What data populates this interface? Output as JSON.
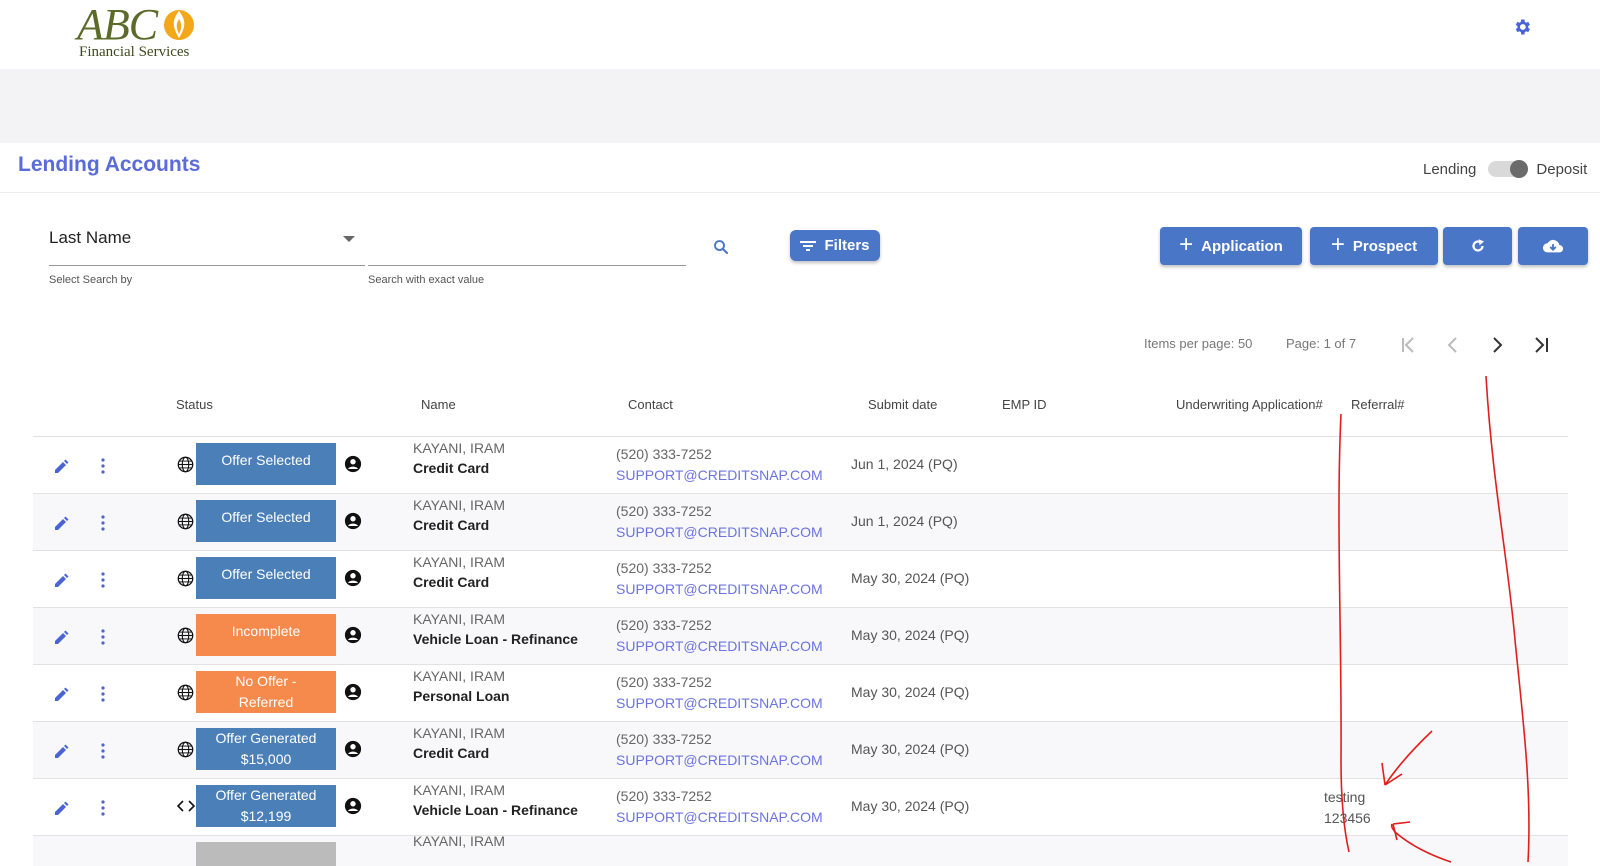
{
  "brand": {
    "logo_text": "ABC",
    "logo_subtitle": "Financial Services"
  },
  "header": {
    "settings_icon": "gear-icon"
  },
  "page": {
    "title": "Lending Accounts"
  },
  "toggle": {
    "left_label": "Lending",
    "right_label": "Deposit",
    "selected": "Deposit"
  },
  "search": {
    "select_value": "Last Name",
    "select_hint": "Select Search by",
    "input_placeholder": "",
    "input_hint": "Search with exact value"
  },
  "toolbar": {
    "filters_label": "Filters",
    "application_label": "Application",
    "prospect_label": "Prospect",
    "refresh_icon": "refresh-icon",
    "download_icon": "cloud-download-icon"
  },
  "pagination": {
    "items_per_page": "Items per page: 50",
    "page_info": "Page: 1 of 7"
  },
  "table": {
    "headers": {
      "status": "Status",
      "name": "Name",
      "contact": "Contact",
      "submit_date": "Submit date",
      "emp_id": "EMP ID",
      "underwriting": "Underwriting Application#",
      "referral": "Referral#"
    },
    "rows": [
      {
        "channel_icon": "globe-icon",
        "status": "Offer Selected",
        "status_color": "#4a7fb8",
        "last_first": "KAYANI,  IRAM",
        "product": "Credit Card",
        "phone": "(520) 333-7252",
        "email": "SUPPORT@CREDITSNAP.COM",
        "date": "Jun 1, 2024 (PQ)",
        "referral_1": "",
        "referral_2": ""
      },
      {
        "channel_icon": "globe-icon",
        "status": "Offer Selected",
        "status_color": "#4a7fb8",
        "last_first": "KAYANI,  IRAM",
        "product": "Credit Card",
        "phone": "(520) 333-7252",
        "email": "SUPPORT@CREDITSNAP.COM",
        "date": "Jun 1, 2024 (PQ)",
        "referral_1": "",
        "referral_2": ""
      },
      {
        "channel_icon": "globe-icon",
        "status": "Offer Selected",
        "status_color": "#4a7fb8",
        "last_first": "KAYANI,  IRAM",
        "product": "Credit Card",
        "phone": "(520) 333-7252",
        "email": "SUPPORT@CREDITSNAP.COM",
        "date": "May 30, 2024 (PQ)",
        "referral_1": "",
        "referral_2": ""
      },
      {
        "channel_icon": "globe-icon",
        "status": "Incomplete",
        "status_color": "#f58a4c",
        "last_first": "KAYANI,  IRAM",
        "product": "Vehicle Loan - Refinance",
        "phone": "(520) 333-7252",
        "email": "SUPPORT@CREDITSNAP.COM",
        "date": "May 30, 2024 (PQ)",
        "referral_1": "",
        "referral_2": ""
      },
      {
        "channel_icon": "globe-icon",
        "status_line1": "No Offer -",
        "status_line2": "Referred",
        "status_color": "#f58a4c",
        "last_first": "KAYANI,  IRAM",
        "product": "Personal Loan",
        "phone": "(520) 333-7252",
        "email": "SUPPORT@CREDITSNAP.COM",
        "date": "May 30, 2024 (PQ)",
        "referral_1": "",
        "referral_2": ""
      },
      {
        "channel_icon": "globe-icon",
        "status_line1": "Offer Generated",
        "status_line2": "$15,000",
        "status_color": "#4a7fb8",
        "last_first": "KAYANI,  IRAM",
        "product": "Credit Card",
        "phone": "(520) 333-7252",
        "email": "SUPPORT@CREDITSNAP.COM",
        "date": "May 30, 2024 (PQ)",
        "referral_1": "",
        "referral_2": ""
      },
      {
        "channel_icon": "code-icon",
        "status_line1": "Offer Generated",
        "status_line2": "$12,199",
        "status_color": "#4a7fb8",
        "last_first": "KAYANI,  IRAM",
        "product": "Vehicle Loan - Refinance",
        "phone": "(520) 333-7252",
        "email": "SUPPORT@CREDITSNAP.COM",
        "date": "May 30, 2024 (PQ)",
        "referral_1": "testing",
        "referral_2": "123456"
      },
      {
        "channel_icon": "",
        "status": "",
        "status_color": "#bbbbbb",
        "last_first": "KAYANI,  IRAM",
        "product": "",
        "phone": "",
        "email": "",
        "date": "",
        "referral_1": "",
        "referral_2": ""
      }
    ]
  }
}
